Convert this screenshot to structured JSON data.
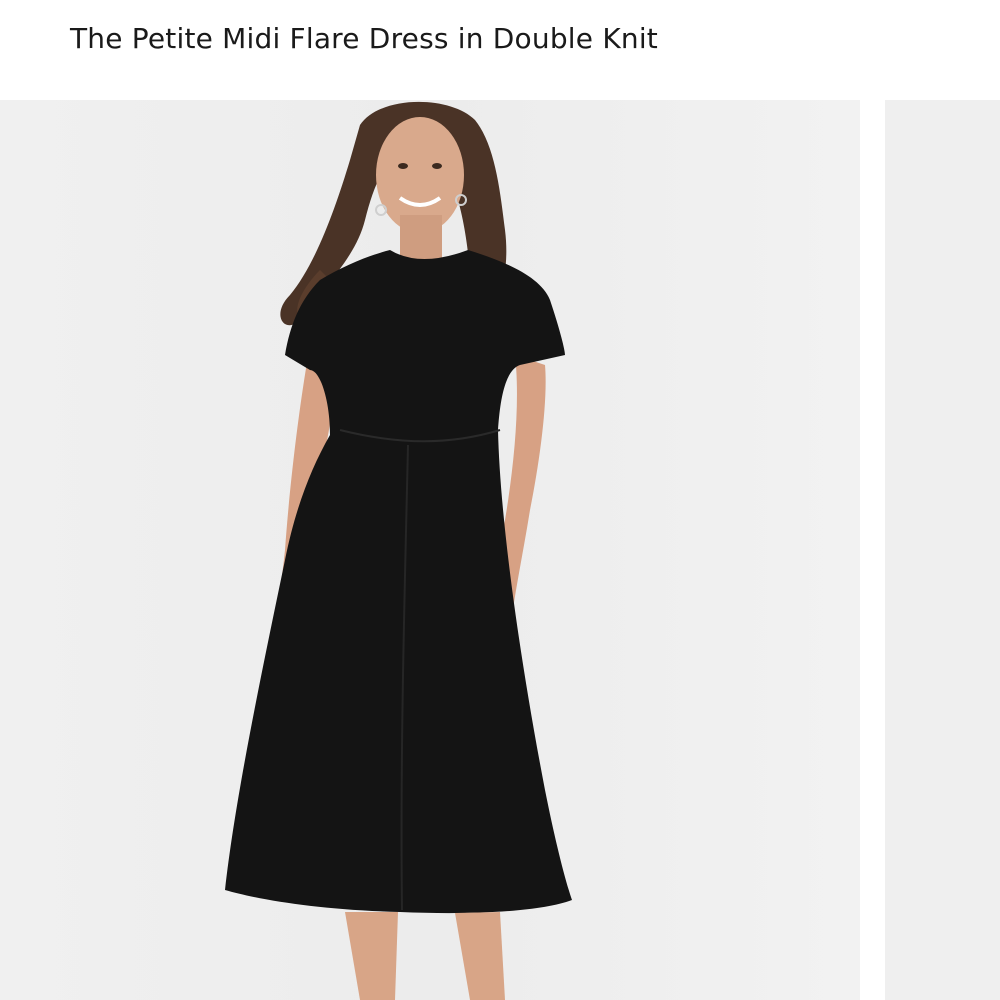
{
  "product": {
    "title": "The Petite Midi Flare Dress in Double Knit"
  },
  "gallery": {
    "images": [
      {
        "icon": "product-photo",
        "subject": "model-black-midi-dress"
      },
      {
        "icon": "product-photo",
        "subject": "next-slide-partial"
      }
    ]
  },
  "colors": {
    "background": "#ffffff",
    "photo_backdrop": "#eeeeee",
    "title_text": "#1a1a1a",
    "dress": "#121212"
  }
}
